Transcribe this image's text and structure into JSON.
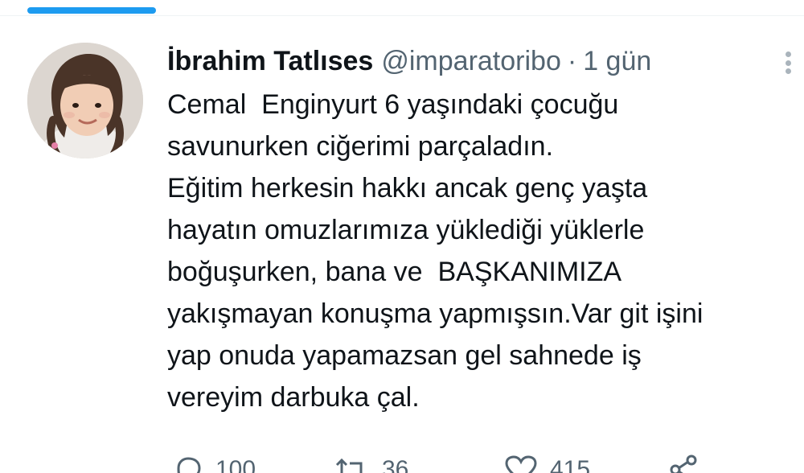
{
  "tweet": {
    "author": {
      "display_name": "İbrahim Tatlıses",
      "handle": "@imparatoribo",
      "avatar_icon": "avatar-photo"
    },
    "separator": "·",
    "timestamp": "1 gün",
    "text_lines": [
      "Cemal  Enginyurt 6 yaşındaki çocuğu",
      "savunurken ciğerimi parçaladın.",
      "Eğitim herkesin hakkı ancak genç yaşta",
      "hayatın omuzlarımıza yüklediği yüklerle",
      "boğuşurken, bana ve  BAŞKANIMIZA",
      "yakışmayan konuşma yapmışsın.Var git işini",
      "yap onuda yapamazsan gel sahnede iş",
      "vereyim darbuka çal."
    ],
    "actions": {
      "reply": {
        "icon": "reply-icon",
        "count": "100"
      },
      "retweet": {
        "icon": "retweet-icon",
        "count": "36"
      },
      "like": {
        "icon": "heart-icon",
        "count": "415"
      },
      "share": {
        "icon": "share-icon"
      }
    }
  },
  "colors": {
    "accent": "#1d9bf0",
    "text_primary": "#0f1419",
    "text_secondary": "#536471"
  }
}
